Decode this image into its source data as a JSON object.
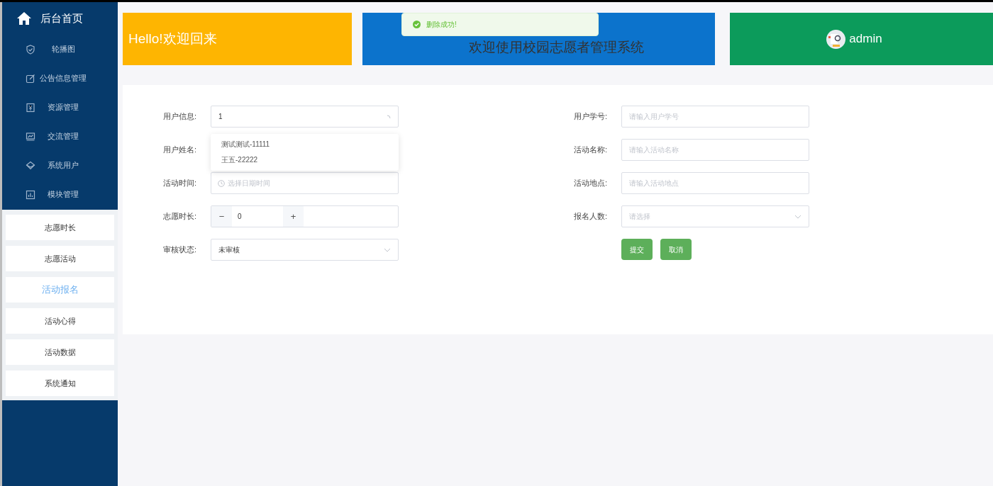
{
  "sidebar": {
    "title": "后台首页",
    "menu": [
      {
        "label": "轮播图"
      },
      {
        "label": "公告信息管理"
      },
      {
        "label": "资源管理"
      },
      {
        "label": "交流管理"
      },
      {
        "label": "系统用户"
      },
      {
        "label": "模块管理"
      }
    ],
    "submenu": [
      {
        "label": "志愿时长",
        "selected": false
      },
      {
        "label": "志愿活动",
        "selected": false
      },
      {
        "label": "活动报名",
        "selected": true
      },
      {
        "label": "活动心得",
        "selected": false
      },
      {
        "label": "活动数据",
        "selected": false
      },
      {
        "label": "系统通知",
        "selected": false
      }
    ]
  },
  "banners": {
    "greeting": "Hello!欢迎回来",
    "system_title": "欢迎使用校园志愿者管理系统",
    "user": "admin"
  },
  "toast": {
    "message": "删除成功!"
  },
  "form": {
    "left": [
      {
        "kind": "autocomplete",
        "label": "用户信息:",
        "value": "1"
      },
      {
        "kind": "text",
        "label": "用户姓名:"
      },
      {
        "kind": "date",
        "label": "活动时间:",
        "placeholder": "选择日期时间"
      },
      {
        "kind": "number",
        "label": "志愿时长:",
        "value": "0",
        "minus": "−",
        "plus": "+"
      },
      {
        "kind": "select",
        "label": "审核状态:",
        "value": "未审核"
      }
    ],
    "right": [
      {
        "kind": "text",
        "label": "用户学号:",
        "placeholder": "请输入用户学号"
      },
      {
        "kind": "text",
        "label": "活动名称:",
        "placeholder": "请输入活动名称"
      },
      {
        "kind": "text",
        "label": "活动地点:",
        "placeholder": "请输入活动地点"
      },
      {
        "kind": "select",
        "label": "报名人数:",
        "placeholder": "请选择"
      }
    ],
    "buttons": [
      "提交",
      "取消"
    ],
    "suggestions": [
      "测试测试-11111",
      "王五-22222"
    ]
  }
}
